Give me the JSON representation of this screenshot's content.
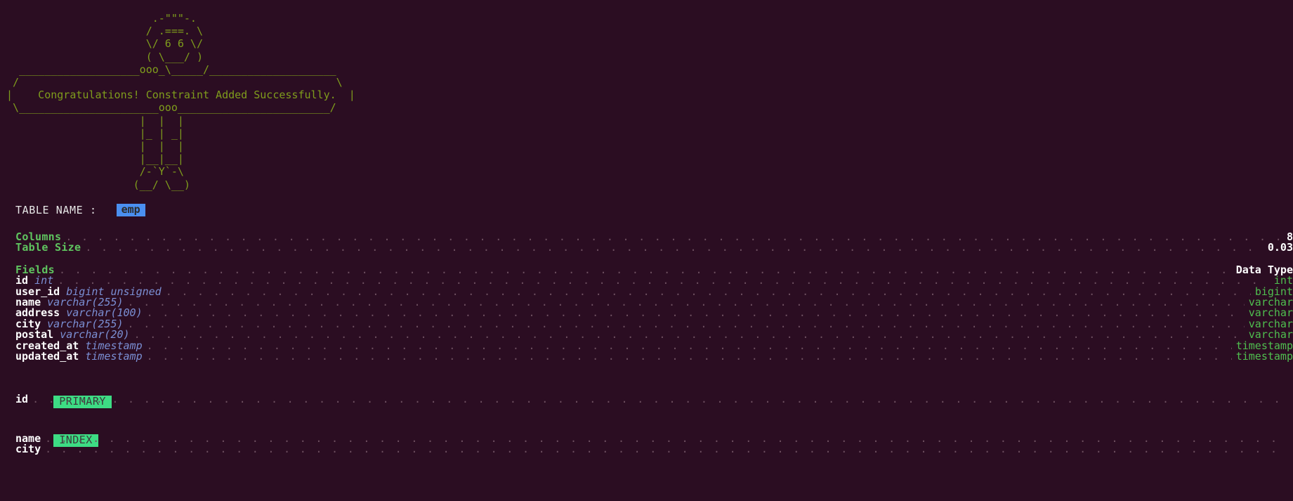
{
  "banner": {
    "ascii_art": "                        .-\"\"\"-.\n                       / .===. \\\n                       \\/ 6 6 \\/\n                       ( \\___/ )\n   ___________________ooo_\\_____/____________________\n  /                                                  \\\n |    Congratulations! Constraint Added Successfully.  |\n  \\______________________ooo________________________/\n                      |  |  |\n                      |_ | _|\n                      |  |  |\n                      |__|__|\n                      /-`Y`-\\\n                     (__/ \\__)",
    "message": "Congratulations! Constraint Added Successfully."
  },
  "table": {
    "name_label": "TABLE NAME :",
    "name_value": "emp"
  },
  "summary": {
    "rows": [
      {
        "label": "Columns",
        "value": "8"
      },
      {
        "label": "Table Size",
        "value": "0.03"
      }
    ]
  },
  "fields": {
    "header_left": "Fields",
    "header_right": "Data Type",
    "items": [
      {
        "name": "id",
        "type": "int",
        "data_type": "int"
      },
      {
        "name": "user_id",
        "type": "bigint unsigned",
        "data_type": "bigint"
      },
      {
        "name": "name",
        "type": "varchar(255)",
        "data_type": "varchar"
      },
      {
        "name": "address",
        "type": "varchar(100)",
        "data_type": "varchar"
      },
      {
        "name": "city",
        "type": "varchar(255)",
        "data_type": "varchar"
      },
      {
        "name": "postal",
        "type": "varchar(20)",
        "data_type": "varchar"
      },
      {
        "name": "created_at",
        "type": "timestamp",
        "data_type": "timestamp"
      },
      {
        "name": "updated_at",
        "type": "timestamp",
        "data_type": "timestamp"
      }
    ]
  },
  "keys": [
    {
      "badge": "PRIMARY",
      "columns": [
        "id"
      ]
    },
    {
      "badge": "INDEX",
      "columns": [
        "name",
        "city"
      ]
    }
  ],
  "colors": {
    "background": "#2b0d22",
    "ascii": "#7f9d1c",
    "accent_blue": "#4a8ff0",
    "accent_green": "#3ddc84",
    "header_green": "#5fc45f",
    "type_blue": "#7b8fd4",
    "datatype_green": "#4fbf4f",
    "dots": "#6e5060"
  }
}
